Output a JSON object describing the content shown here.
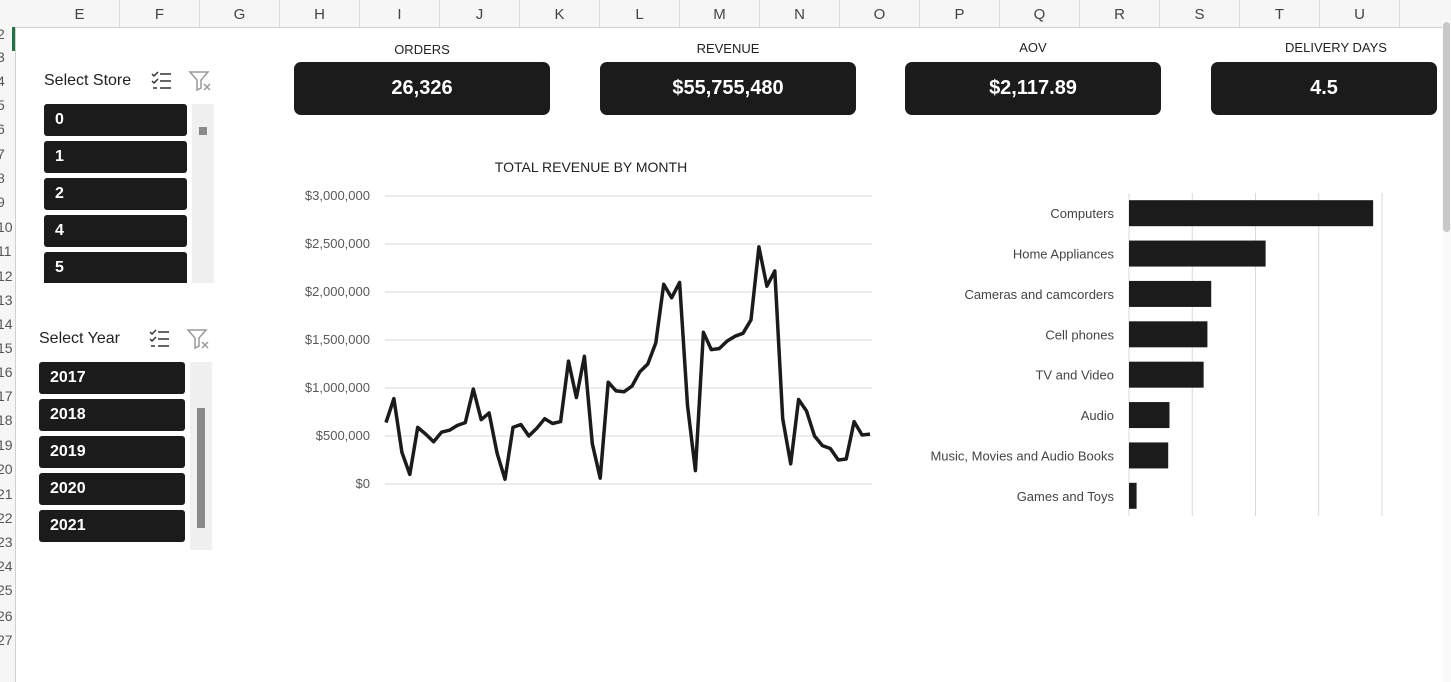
{
  "columns": [
    "E",
    "F",
    "G",
    "H",
    "I",
    "J",
    "K",
    "L",
    "M",
    "N",
    "O",
    "P",
    "Q",
    "R",
    "S",
    "T",
    "U"
  ],
  "rows": [
    "2",
    "3",
    "4",
    "5",
    "6",
    "7",
    "8",
    "9",
    "10",
    "11",
    "12",
    "13",
    "14",
    "15",
    "16",
    "17",
    "18",
    "19",
    "20",
    "21",
    "22",
    "23",
    "24",
    "25",
    "26",
    "27"
  ],
  "store_slicer": {
    "title": "Select Store",
    "items": [
      "0",
      "1",
      "2",
      "4",
      "5"
    ]
  },
  "year_slicer": {
    "title": "Select Year",
    "items": [
      "2017",
      "2018",
      "2019",
      "2020",
      "2021"
    ]
  },
  "icons": {
    "multi_select": "multi-select-icon",
    "clear_filter": "clear-filter-icon"
  },
  "kpis": [
    {
      "label": "ORDERS",
      "value": "26,326"
    },
    {
      "label": "REVENUE",
      "value": "$55,755,480"
    },
    {
      "label": "AOV",
      "value": "$2,117.89"
    },
    {
      "label": "DELIVERY DAYS",
      "value": "4.5"
    }
  ],
  "colors": {
    "dark": "#1b1b1b",
    "excel_green": "#217346"
  },
  "chart_data": [
    {
      "type": "line",
      "title": "TOTAL REVENUE BY MONTH",
      "xlabel": "",
      "ylabel": "",
      "ylim": [
        0,
        3000000
      ],
      "yticks": [
        "$0",
        "$500,000",
        "$1,000,000",
        "$1,500,000",
        "$2,000,000",
        "$2,500,000",
        "$3,000,000"
      ],
      "grid": true,
      "series": [
        {
          "values": [
            640000,
            890000,
            330000,
            100000,
            590000,
            520000,
            440000,
            540000,
            560000,
            610000,
            640000,
            990000,
            670000,
            740000,
            320000,
            50000,
            590000,
            620000,
            500000,
            580000,
            680000,
            630000,
            650000,
            1280000,
            900000,
            1330000,
            420000,
            60000,
            1060000,
            970000,
            960000,
            1020000,
            1170000,
            1250000,
            1470000,
            2080000,
            1940000,
            2100000,
            820000,
            140000,
            1580000,
            1400000,
            1410000,
            1490000,
            1540000,
            1570000,
            1710000,
            2470000,
            2060000,
            2220000,
            680000,
            210000,
            880000,
            760000,
            500000,
            400000,
            370000,
            250000,
            260000,
            650000,
            510000,
            520000
          ]
        }
      ]
    },
    {
      "type": "bar",
      "orientation": "horizontal",
      "title": "",
      "categories": [
        "Computers",
        "Home Appliances",
        "Cameras and camcorders",
        "Cell phones",
        "TV and Video",
        "Audio",
        "Music, Movies and Audio Books",
        "Games and Toys"
      ],
      "values": [
        19.3,
        10.8,
        6.5,
        6.2,
        5.9,
        3.2,
        3.1,
        0.6
      ],
      "xlim": [
        0,
        20
      ],
      "grid": true
    }
  ]
}
